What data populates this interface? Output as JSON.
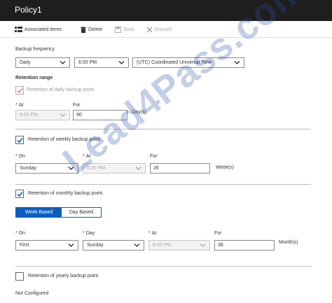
{
  "window": {
    "title": "Policy1"
  },
  "toolbar": {
    "associated_items": "Associated items",
    "delete": "Delete",
    "save": "Save",
    "discard": "Discard"
  },
  "backup_frequency": {
    "label": "Backup frequency",
    "frequency": "Daily",
    "time": "6:00 PM",
    "timezone": "(UTC) Coordinated Universal Time"
  },
  "retention": {
    "heading": "Retention range",
    "daily": {
      "label": "Retention of daily backup point.",
      "checked": true,
      "at_label": "At",
      "at_value": "6:00 PM",
      "for_label": "For",
      "for_value": "90",
      "unit": "Day(s)"
    },
    "weekly": {
      "label": "Retention of weekly backup point.",
      "checked": true,
      "on_label": "On",
      "on_value": "Sunday",
      "at_label": "At",
      "at_value": "6:00 PM",
      "for_label": "For",
      "for_value": "26",
      "unit": "Week(s)"
    },
    "monthly": {
      "label": "Retention of monthly backup point.",
      "checked": true,
      "toggle_week": "Week Based",
      "toggle_day": "Day Based",
      "selected": "Week Based",
      "on_label": "On",
      "on_value": "First",
      "day_label": "Day",
      "day_value": "Sunday",
      "at_label": "At",
      "at_value": "6:00 PM",
      "for_label": "For",
      "for_value": "36",
      "unit": "Month(s)"
    },
    "yearly": {
      "label": "Retention of yearly backup point.",
      "checked": false,
      "status": "Not Configured"
    }
  },
  "watermark": "Lead4Pass.com",
  "colors": {
    "titlebar": "#1e1e1e",
    "accent": "#0a5ec2",
    "required": "#cc0000"
  }
}
